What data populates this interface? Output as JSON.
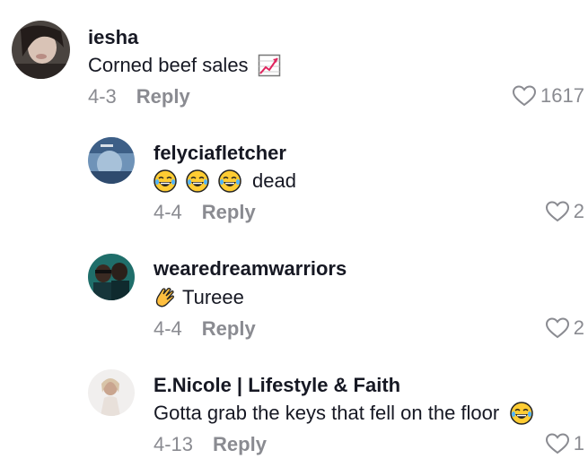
{
  "comments": [
    {
      "username": "iesha",
      "text": "Corned beef sales",
      "emoji": "chart-increasing-emoji",
      "date": "4-3",
      "reply_label": "Reply",
      "likes": "1617"
    },
    {
      "username": "felyciafletcher",
      "text": "dead",
      "emoji": "face-with-tears-of-joy-emoji",
      "date": "4-4",
      "reply_label": "Reply",
      "likes": "2"
    },
    {
      "username": "wearedreamwarriors",
      "text": "Tureee",
      "emoji": "clapping-hands-emoji",
      "date": "4-4",
      "reply_label": "Reply",
      "likes": "2"
    },
    {
      "username": "E.Nicole | Lifestyle & Faith",
      "text": "Gotta grab the keys that fell on the floor",
      "emoji": "face-with-tears-of-joy-emoji",
      "date": "4-13",
      "reply_label": "Reply",
      "likes": "1"
    }
  ],
  "icons": {
    "like": "heart-outline-icon"
  },
  "colors": {
    "text": "#161823",
    "secondary": "#8a8b91"
  }
}
